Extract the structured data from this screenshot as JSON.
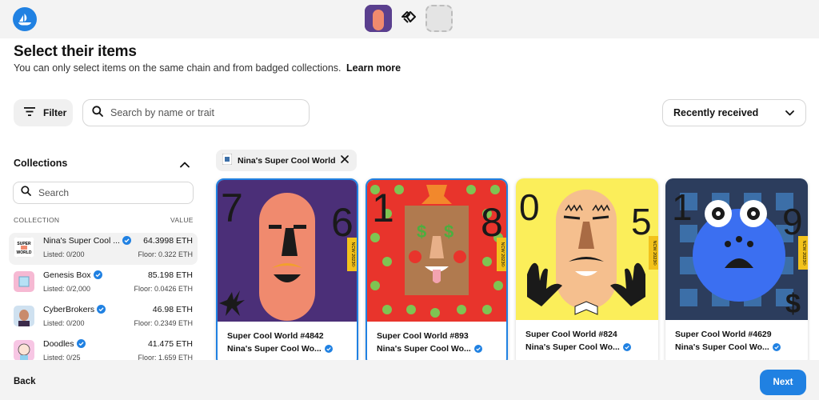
{
  "header": {
    "logo_icon": "opensea-logo-icon",
    "swap_icon": "handshake-icon"
  },
  "page": {
    "title": "Select their items",
    "subtitle": "You can only select items on the same chain and from badged collections.",
    "learn_more": "Learn more"
  },
  "toolbar": {
    "filter_label": "Filter",
    "search_placeholder": "Search by name or trait",
    "sort_selected": "Recently received"
  },
  "sidebar": {
    "title": "Collections",
    "search_placeholder": "Search",
    "col_collection": "COLLECTION",
    "col_value": "VALUE",
    "collections": [
      {
        "name": "Nina's Super Cool ...",
        "listed": "Listed: 0/200",
        "value": "64.3998 ETH",
        "floor": "Floor: 0.322 ETH",
        "selected": true
      },
      {
        "name": "Genesis Box",
        "listed": "Listed: 0/2,000",
        "value": "85.198 ETH",
        "floor": "Floor: 0.0426 ETH",
        "selected": false
      },
      {
        "name": "CyberBrokers",
        "listed": "Listed: 0/200",
        "value": "46.98 ETH",
        "floor": "Floor: 0.2349 ETH",
        "selected": false
      },
      {
        "name": "Doodles",
        "listed": "Listed: 0/25",
        "value": "41.475 ETH",
        "floor": "Floor: 1.659 ETH",
        "selected": false
      }
    ]
  },
  "active_filter": {
    "label": "Nina's Super Cool World"
  },
  "items": [
    {
      "title": "Super Cool World #4842",
      "collection": "Nina's Super Cool Wo...",
      "selected": true,
      "left_number": "7",
      "right_number": "6",
      "bg": "#4b2f78",
      "side_text": "NCW 2023©"
    },
    {
      "title": "Super Cool World #893",
      "collection": "Nina's Super Cool Wo...",
      "selected": true,
      "left_number": "1",
      "right_number": "8",
      "bg": "#e8342c",
      "side_text": "NCW 2023©"
    },
    {
      "title": "Super Cool World #824",
      "collection": "Nina's Super Cool Wo...",
      "selected": false,
      "left_number": "0",
      "right_number": "5",
      "bg": "#fbee5a",
      "side_text": "NCW 2023©"
    },
    {
      "title": "Super Cool World #4629",
      "collection": "Nina's Super Cool Wo...",
      "selected": false,
      "left_number": "1",
      "right_number": "9",
      "bg": "#3c6fa8",
      "side_text": "NCW 2023©"
    }
  ],
  "footer": {
    "back_label": "Back",
    "next_label": "Next"
  },
  "colors": {
    "accent": "#2081e2",
    "verified": "#2081e2"
  }
}
